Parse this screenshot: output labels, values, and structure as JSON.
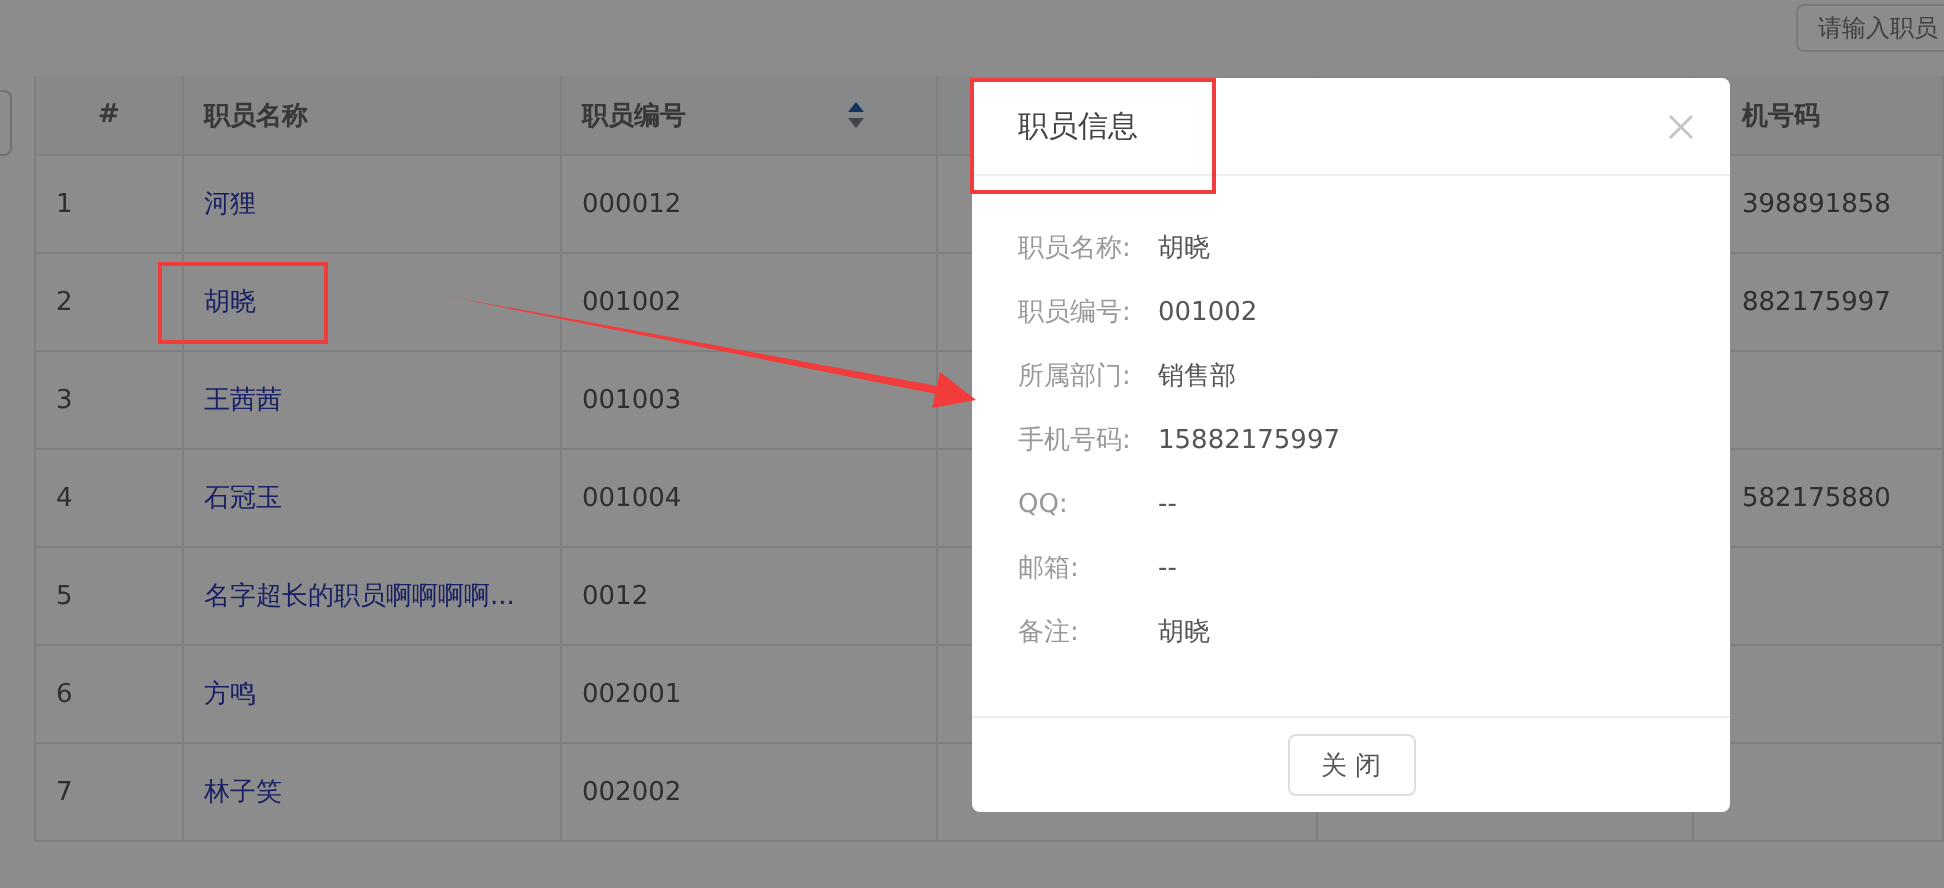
{
  "search": {
    "placeholder": "请输入职员"
  },
  "table": {
    "columns": [
      {
        "label": "#"
      },
      {
        "label": "职员名称"
      },
      {
        "label": "职员编号",
        "sortable": true
      },
      {},
      {},
      {
        "label": "机号码"
      }
    ],
    "rows": [
      {
        "index": "1",
        "name": "河狸",
        "code": "000012",
        "phone": "398891858"
      },
      {
        "index": "2",
        "name": "胡晓",
        "code": "001002",
        "phone": "882175997"
      },
      {
        "index": "3",
        "name": "王茜茜",
        "code": "001003"
      },
      {
        "index": "4",
        "name": "石冠玉",
        "code": "001004",
        "phone": "582175880"
      },
      {
        "index": "5",
        "name": "名字超长的职员啊啊啊啊...",
        "code": "0012"
      },
      {
        "index": "6",
        "name": "方鸣",
        "code": "002001"
      },
      {
        "index": "7",
        "name": "林子笑",
        "code": "002002"
      }
    ]
  },
  "dialog": {
    "title": "职员信息",
    "fields": [
      {
        "label": "职员名称:",
        "value": "胡晓"
      },
      {
        "label": "职员编号:",
        "value": "001002"
      },
      {
        "label": "所属部门:",
        "value": "销售部"
      },
      {
        "label": "手机号码:",
        "value": "15882175997"
      },
      {
        "label": "QQ:",
        "value": "--"
      },
      {
        "label": "邮箱:",
        "value": "--"
      },
      {
        "label": "备注:",
        "value": "胡晓"
      }
    ],
    "button": "关 闭"
  }
}
